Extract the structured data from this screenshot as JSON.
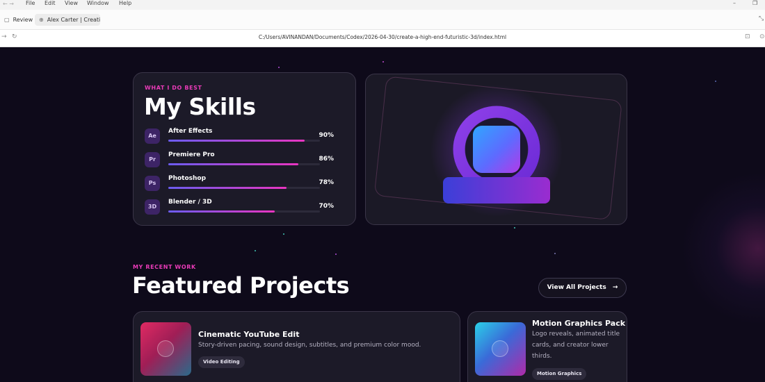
{
  "menubar": {
    "items": [
      "File",
      "Edit",
      "View",
      "Window",
      "Help"
    ],
    "minimize": "–",
    "restore": "❐"
  },
  "tabs": {
    "review": "Review",
    "active": "Alex Carter | Creative"
  },
  "address": {
    "url": "C:/Users/AVINANDAN/Documents/Codex/2026-04-30/create-a-high-end-futuristic-3d/index.html"
  },
  "skills": {
    "eyebrow": "WHAT I DO BEST",
    "title": "My Skills",
    "items": [
      {
        "badge": "Ae",
        "name": "After Effects",
        "percent_label": "90%",
        "percent": 90
      },
      {
        "badge": "Pr",
        "name": "Premiere Pro",
        "percent_label": "86%",
        "percent": 86
      },
      {
        "badge": "Ps",
        "name": "Photoshop",
        "percent_label": "78%",
        "percent": 78
      },
      {
        "badge": "3D",
        "name": "Blender / 3D",
        "percent_label": "70%",
        "percent": 70
      }
    ]
  },
  "projects": {
    "eyebrow": "MY RECENT WORK",
    "title": "Featured Projects",
    "view_all": "View All Projects",
    "items": [
      {
        "title": "Cinematic YouTube Edit",
        "description": "Story-driven pacing, sound design, subtitles, and premium color mood.",
        "tag": "Video Editing"
      },
      {
        "title": "Motion Graphics Pack",
        "description": "Logo reveals, animated title cards, and creator lower thirds.",
        "tag": "Motion Graphics"
      }
    ]
  },
  "colors": {
    "accent_pink": "#e93bb8",
    "accent_purple": "#7a3df0",
    "background": "#0e0a1a",
    "card": "#1c1a28"
  }
}
